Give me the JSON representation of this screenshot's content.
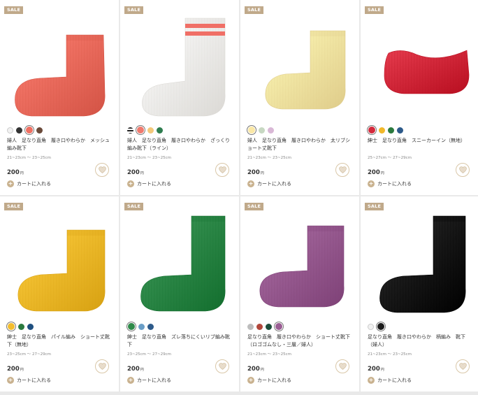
{
  "products": [
    {
      "badge": "SALE",
      "sock_icon": "coral-mesh-ankle-sock",
      "sock_color": "#ef6f61",
      "swatches": [
        {
          "color": "#f1f1f1",
          "selected": false
        },
        {
          "color": "#333333",
          "selected": false
        },
        {
          "color": "#ef6f61",
          "selected": true
        },
        {
          "color": "#6b4a3a",
          "selected": false
        }
      ],
      "title": "婦人　足なり直角　履き口やわらか　メッシュ編み靴下",
      "size": "21~23cm 〜 23~25cm",
      "price": "200",
      "currency": "円",
      "cart_label": "カートに入れる"
    },
    {
      "badge": "SALE",
      "sock_icon": "white-striped-crew-sock",
      "sock_color": "#f7f5f1",
      "swatches": [
        {
          "color": "striped",
          "selected": false
        },
        {
          "color": "#f07a6e",
          "selected": true
        },
        {
          "color": "#f3c87a",
          "selected": false
        },
        {
          "color": "#2e7d4f",
          "selected": false
        }
      ],
      "title": "婦人　足なり直角　履き口やわらか　ざっくり編み靴下（ライン）",
      "size": "21~23cm 〜 23~25cm",
      "price": "200",
      "currency": "円",
      "cart_label": "カートに入れる"
    },
    {
      "badge": "SALE",
      "sock_icon": "yellow-rib-short-sock",
      "sock_color": "#fbe8a6",
      "swatches": [
        {
          "color": "#fbe8a6",
          "selected": true
        },
        {
          "color": "#c7d8c2",
          "selected": false
        },
        {
          "color": "#d9b8d6",
          "selected": false
        }
      ],
      "title": "婦人　足なり直角　履き口やわらか　太リブショート丈靴下",
      "size": "21~23cm 〜 23~25cm",
      "price": "200",
      "currency": "円",
      "cart_label": "カートに入れる"
    },
    {
      "badge": "SALE",
      "sock_icon": "red-sneaker-liner-sock",
      "sock_color": "#d42a3c",
      "swatches": [
        {
          "color": "#d42a3c",
          "selected": true
        },
        {
          "color": "#f1b829",
          "selected": false
        },
        {
          "color": "#2b7a3e",
          "selected": false
        },
        {
          "color": "#2d5a8a",
          "selected": false
        }
      ],
      "title": "紳士　足なり直角　スニーカーイン（無地）",
      "size": "25~27cm 〜 27~29cm",
      "price": "200",
      "currency": "円",
      "cart_label": "カートに入れる"
    },
    {
      "badge": "SALE",
      "sock_icon": "mustard-pile-short-sock",
      "sock_color": "#f3bd2e",
      "swatches": [
        {
          "color": "#f3bd2e",
          "selected": true
        },
        {
          "color": "#2b7a3e",
          "selected": false
        },
        {
          "color": "#1f4f80",
          "selected": false
        }
      ],
      "title": "紳士　足なり直角　パイル編み　ショート丈靴下（無地）",
      "size": "23~25cm 〜 27~29cm",
      "price": "200",
      "currency": "円",
      "cart_label": "カートに入れる"
    },
    {
      "badge": "SALE",
      "sock_icon": "green-rib-crew-sock",
      "sock_color": "#2f8a4a",
      "swatches": [
        {
          "color": "#2f8a4a",
          "selected": true
        },
        {
          "color": "#6a9ec7",
          "selected": false
        },
        {
          "color": "#2d5a8a",
          "selected": false
        }
      ],
      "title": "紳士　足なり直角　ズレ落ちにくいリブ編み靴下",
      "size": "23~25cm 〜 27~29cm",
      "price": "200",
      "currency": "円",
      "cart_label": "カートに入れる"
    },
    {
      "badge": "SALE",
      "sock_icon": "purple-short-sock",
      "sock_color": "#9a5d93",
      "swatches": [
        {
          "color": "#bdbdbd",
          "selected": false
        },
        {
          "color": "#b2473b",
          "selected": false
        },
        {
          "color": "#1d4d3b",
          "selected": false
        },
        {
          "color": "#9a5d93",
          "selected": true
        }
      ],
      "title": "足なり直角　履き口やわらか　ショート丈靴下（ロゴゴムなし・三層／婦人）",
      "size": "21~23cm 〜 23~25cm",
      "price": "200",
      "currency": "円",
      "cart_label": "カートに入れる"
    },
    {
      "badge": "SALE",
      "sock_icon": "black-crew-sock",
      "sock_color": "#1c1c1c",
      "swatches": [
        {
          "color": "#f1f1f1",
          "selected": false
        },
        {
          "color": "#1c1c1c",
          "selected": true
        }
      ],
      "title": "足なり直角　履き口やわらか　柄編み　靴下（婦人）",
      "size": "21~23cm 〜 23~25cm",
      "price": "200",
      "currency": "円",
      "cart_label": "カートに入れる"
    }
  ]
}
